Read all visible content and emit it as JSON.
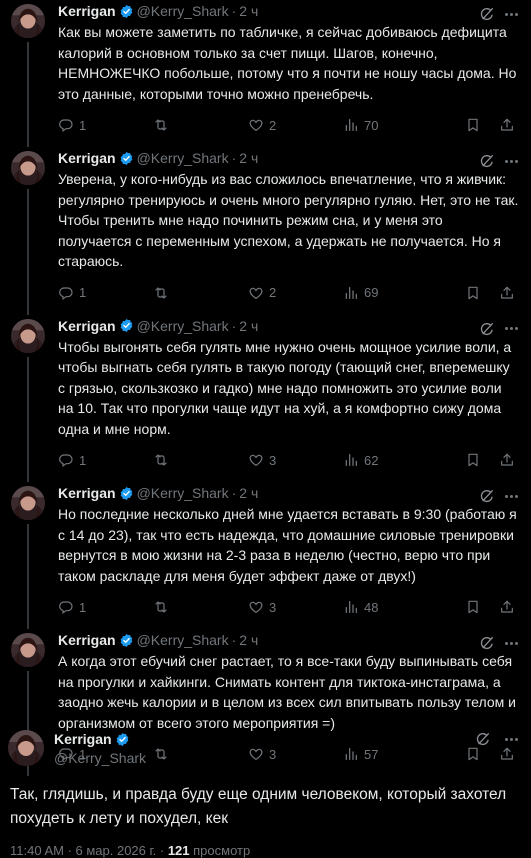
{
  "author": {
    "name": "Kerrigan",
    "handle": "@Kerry_Shark",
    "sep": "·",
    "time": "2 ч"
  },
  "tweets": [
    {
      "text": "Как вы можете заметить по табличке, я сейчас добиваюсь дефицита калорий в основном только за счет пищи. Шагов, конечно, НЕМНОЖЕЧКО побольше, потому что я почти не ношу часы дома. Но это данные, которыми точно можно пренебречь.",
      "replies": "1",
      "reposts": "",
      "likes": "2",
      "views": "70"
    },
    {
      "text": "Уверена, у кого-нибудь из вас сложилось впечатление, что я живчик: регулярно тренируюсь и очень много регулярно гуляю. Нет, это не так. Чтобы тренить мне надо починить режим сна, и у меня это получается с переменным успехом, а удержать не получается. Но я стараюсь.",
      "replies": "1",
      "reposts": "",
      "likes": "2",
      "views": "69"
    },
    {
      "text": "Чтобы выгонять себя гулять мне нужно очень мощное усилие воли, а чтобы выгнать себя гулять в такую погоду (тающий снег, вперемешку с грязью, скользкозко и гадко) мне надо помножить это усилие воли на 10. Так что прогулки чаще идут на хуй, а я комфортно сижу дома одна и мне норм.",
      "replies": "1",
      "reposts": "",
      "likes": "3",
      "views": "62"
    },
    {
      "text": "Но последние несколько дней мне удается вставать в 9:30 (работаю я с 14 до 23), так что есть надежда, что домашние силовые тренировки вернутся в мою жизни на 2-3 раза в неделю (честно, верю что при таком раскладе для меня будет эффект даже от двух!)",
      "replies": "1",
      "reposts": "",
      "likes": "3",
      "views": "48"
    },
    {
      "text": "А когда этот ебучий снег растает, то я все-таки буду выпинывать себя на прогулки и хайкинги. Снимать контент для тиктока-инстаграма, а заодно жечь калории и в целом из всех сил впитывать пользу телом и организмом от всего этого мероприятия =)",
      "replies": "1",
      "reposts": "",
      "likes": "3",
      "views": "57"
    }
  ],
  "main_tweet": {
    "text": "Так, глядишь, и правда буду еще одним человеком, который захотел похудеть к лету и похудел, кек",
    "timestamp": "11:40 AM · 6 мар. 2026 г. · ",
    "views_count": "121",
    "views_label": " просмотр"
  },
  "icons": {
    "reply": "reply-icon",
    "repost": "repost-icon",
    "like": "like-icon",
    "views": "views-icon",
    "bookmark": "bookmark-icon",
    "share": "share-icon",
    "grok": "grok-icon",
    "more": "more-icon",
    "verified": "verified-badge-icon"
  },
  "colors": {
    "background": "#000000",
    "text": "#e7e9ea",
    "secondary": "#71767b",
    "verified": "#1d9bf0",
    "thread_line": "#333639"
  }
}
